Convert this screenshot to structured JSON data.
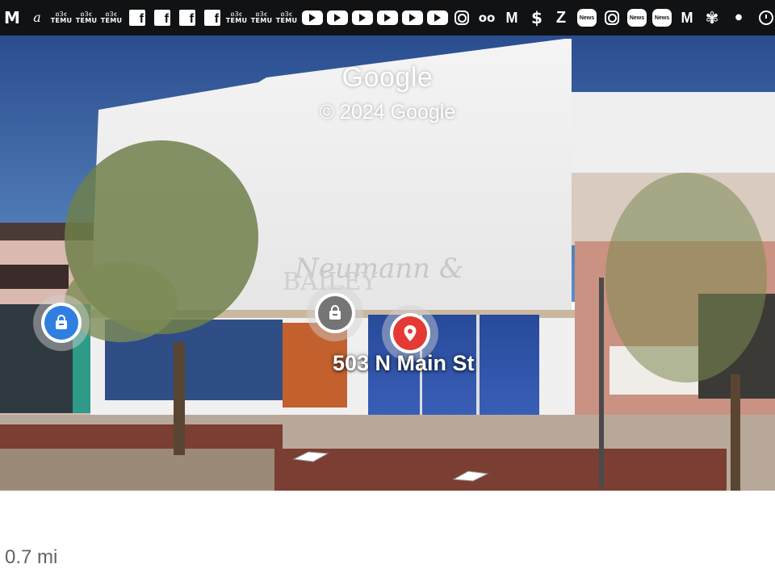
{
  "status_bar": {
    "gmail_glyph": "M",
    "script_glyph": "a",
    "temu_top": "ꞛꞫꞓ",
    "temu_label": "TEMU",
    "facebook_glyph": "f",
    "instagram_glyph": "",
    "voicemail_glyph": "oo",
    "mcdonalds_glyph": "M",
    "dollar_glyph": "$",
    "zillow_glyph": "Z",
    "news_label": "News",
    "fan_glyph": "✾",
    "dot_glyph": "●"
  },
  "street_view": {
    "watermark": "Google",
    "copyright": "© 2024 Google",
    "place_label": "503 N Main St",
    "storefront_sign": "Neumann & Bailey"
  },
  "footer": {
    "distance": "0.7 mi"
  },
  "colors": {
    "status_bar_bg": "#111214",
    "pin_blue": "#2f7fe0",
    "pin_gray": "#757575",
    "pin_red": "#e53935",
    "distance_text": "#5f6368"
  }
}
